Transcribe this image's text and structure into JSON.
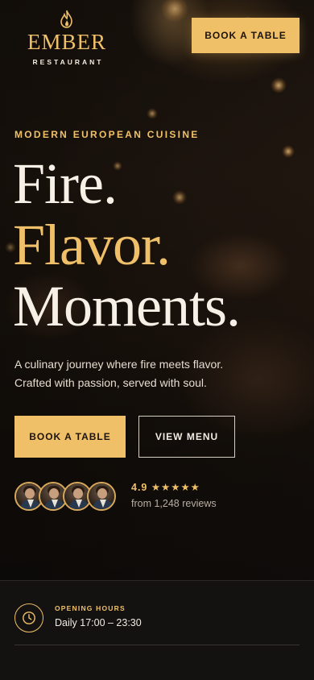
{
  "brand": {
    "name": "EMBER",
    "subtitle": "RESTAURANT"
  },
  "header": {
    "cta_label": "BOOK A TABLE"
  },
  "hero": {
    "eyebrow": "MODERN EUROPEAN CUISINE",
    "headline": [
      "Fire.",
      "Flavor.",
      "Moments."
    ],
    "lede_lines": [
      "A culinary journey where fire meets flavor.",
      "Crafted with passion, served with soul."
    ],
    "primary_cta": "BOOK A TABLE",
    "secondary_cta": "VIEW MENU"
  },
  "social_proof": {
    "rating_text": "4.9 ★★★★★",
    "rating_value": 4.9,
    "reviews_text": "from 1,248 reviews",
    "avatar_count": 4
  },
  "info": {
    "label": "OPENING HOURS",
    "value": "Daily 17:00 – 23:30",
    "icon": "clock-icon"
  },
  "colors": {
    "accent": "#f0c069",
    "background": "#131110",
    "text": "#f6f0e6"
  }
}
